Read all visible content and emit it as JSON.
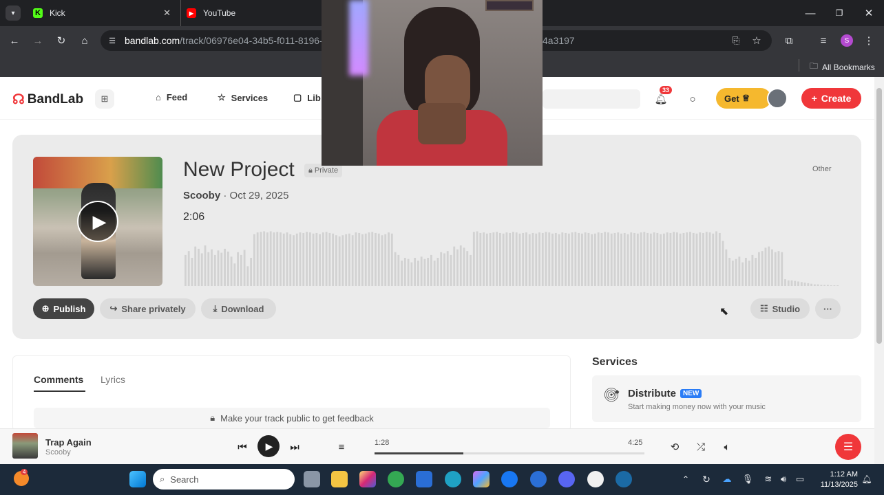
{
  "browser": {
    "tabs": [
      {
        "title": "Kick",
        "active": false
      },
      {
        "title": "YouTube",
        "active": false
      }
    ],
    "url_host": "bandlab.com",
    "url_path_left": "/track/06976e04-34b5-f011-8196-0",
    "url_path_right": "4a3197",
    "profile_initial": "S",
    "bookmarks_label": "All Bookmarks"
  },
  "bandlab": {
    "logo": "BandLab",
    "nav": {
      "feed": "Feed",
      "services": "Services",
      "library": "Lib"
    },
    "notif_count": "33",
    "get_label": "Get",
    "create_label": "Create"
  },
  "track": {
    "title": "New Project",
    "privacy": "Private",
    "artist": "Scooby",
    "date": "· Oct 29, 2025",
    "duration": "2:06",
    "genre": "Other",
    "actions": {
      "publish": "Publish",
      "share": "Share privately",
      "download": "Download",
      "studio": "Studio"
    },
    "waveform": [
      0.55,
      0.62,
      0.5,
      0.7,
      0.66,
      0.58,
      0.72,
      0.6,
      0.65,
      0.55,
      0.63,
      0.59,
      0.66,
      0.61,
      0.52,
      0.4,
      0.6,
      0.55,
      0.64,
      0.35,
      0.5,
      0.92,
      0.95,
      0.96,
      0.97,
      0.95,
      0.97,
      0.95,
      0.96,
      0.95,
      0.93,
      0.95,
      0.92,
      0.9,
      0.93,
      0.95,
      0.94,
      0.96,
      0.95,
      0.93,
      0.94,
      0.92,
      0.95,
      0.96,
      0.94,
      0.93,
      0.9,
      0.88,
      0.9,
      0.92,
      0.93,
      0.9,
      0.95,
      0.94,
      0.92,
      0.93,
      0.95,
      0.96,
      0.94,
      0.93,
      0.9,
      0.92,
      0.95,
      0.93,
      0.6,
      0.55,
      0.45,
      0.5,
      0.48,
      0.42,
      0.5,
      0.45,
      0.52,
      0.48,
      0.5,
      0.55,
      0.45,
      0.5,
      0.6,
      0.58,
      0.62,
      0.55,
      0.7,
      0.65,
      0.72,
      0.68,
      0.62,
      0.55,
      0.96,
      0.97,
      0.94,
      0.95,
      0.93,
      0.94,
      0.95,
      0.96,
      0.94,
      0.93,
      0.95,
      0.94,
      0.96,
      0.95,
      0.93,
      0.94,
      0.95,
      0.92,
      0.94,
      0.93,
      0.95,
      0.94,
      0.96,
      0.95,
      0.93,
      0.94,
      0.92,
      0.95,
      0.94,
      0.93,
      0.95,
      0.96,
      0.94,
      0.93,
      0.95,
      0.94,
      0.92,
      0.93,
      0.95,
      0.94,
      0.96,
      0.95,
      0.93,
      0.94,
      0.95,
      0.93,
      0.94,
      0.92,
      0.95,
      0.94,
      0.93,
      0.95,
      0.96,
      0.94,
      0.93,
      0.95,
      0.94,
      0.92,
      0.93,
      0.95,
      0.94,
      0.96,
      0.95,
      0.93,
      0.94,
      0.95,
      0.96,
      0.94,
      0.93,
      0.95,
      0.94,
      0.96,
      0.95,
      0.93,
      0.97,
      0.94,
      0.8,
      0.65,
      0.5,
      0.45,
      0.48,
      0.52,
      0.42,
      0.5,
      0.45,
      0.55,
      0.5,
      0.6,
      0.62,
      0.68,
      0.7,
      0.65,
      0.6,
      0.62,
      0.6,
      0.12,
      0.1,
      0.1,
      0.09,
      0.08,
      0.07,
      0.06,
      0.05,
      0.04,
      0.03,
      0.03,
      0.02,
      0.02,
      0.02,
      0.01,
      0.01,
      0.01
    ]
  },
  "tabs_section": {
    "comments": "Comments",
    "lyrics": "Lyrics",
    "feedback": "Make your track public to get feedback"
  },
  "services": {
    "heading": "Services",
    "distribute": "Distribute",
    "badge": "NEW",
    "subtitle": "Start making money now with your music"
  },
  "player": {
    "song": "Trap Again",
    "artist": "Scooby",
    "elapsed": "1:28",
    "total": "4:25",
    "progress": 0.33
  },
  "taskbar": {
    "search_placeholder": "Search",
    "time": "1:12 AM",
    "date": "11/13/2025",
    "badge_app": "4"
  },
  "colors": {
    "accent": "#f0373a",
    "get": "#f5b82e"
  }
}
